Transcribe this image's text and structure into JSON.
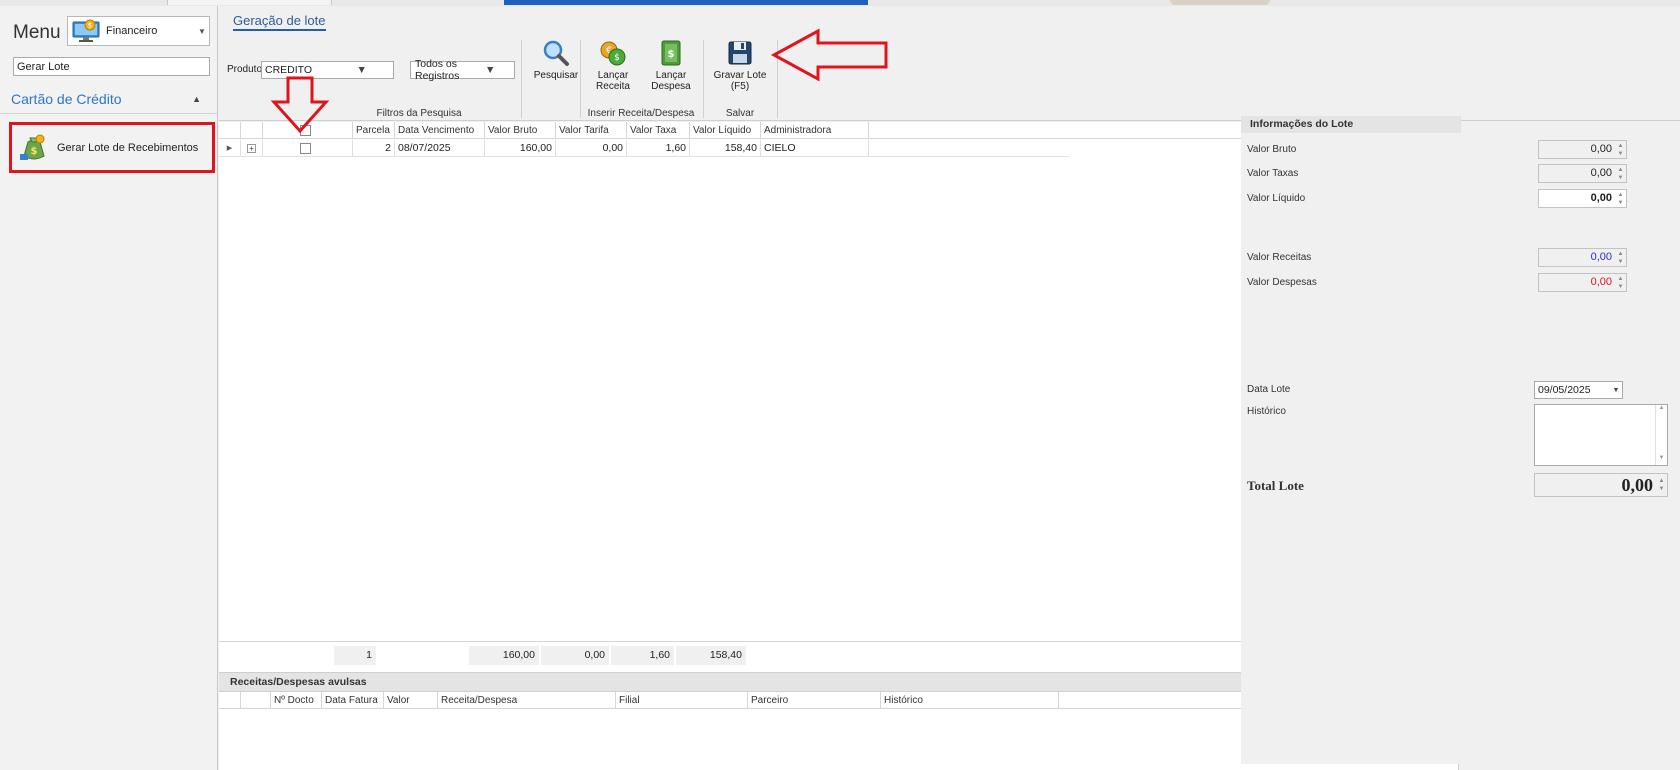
{
  "menu": {
    "title": "Menu",
    "module": "Financeiro",
    "search_value": "Gerar Lote",
    "group": "Cartão de Crédito",
    "item": "Gerar Lote de Recebimentos"
  },
  "doc_tab": "Geração de lote",
  "ribbon": {
    "produto_label": "Produto",
    "produto_value": "CREDITO",
    "registros_value": "Todos os Registros",
    "filters_caption": "Filtros da Pesquisa",
    "pesquisar": "Pesquisar",
    "lancar_receita": [
      "Lançar",
      "Receita"
    ],
    "lancar_despesa": [
      "Lançar",
      "Despesa"
    ],
    "inserir_caption": "Inserir Receita/Despesa",
    "gravar_lote": [
      "Gravar Lote",
      "(F5)"
    ],
    "salvar_caption": "Salvar"
  },
  "grid": {
    "columns": [
      "Parcela",
      "Data Vencimento",
      "Valor Bruto",
      "Valor Tarifa",
      "Valor Taxa",
      "Valor Líquido",
      "Administradora"
    ],
    "rows": [
      {
        "parcela": "2",
        "vencimento": "08/07/2025",
        "bruto": "160,00",
        "tarifa": "0,00",
        "taxa": "1,60",
        "liquido": "158,40",
        "administradora": "CIELO"
      }
    ],
    "footer": {
      "count": "1",
      "bruto": "160,00",
      "tarifa": "0,00",
      "taxa": "1,60",
      "liquido": "158,40"
    }
  },
  "avulsas": {
    "title": "Receitas/Despesas avulsas",
    "columns": [
      "Nº Docto",
      "Data Fatura",
      "Valor",
      "Receita/Despesa",
      "Filial",
      "Parceiro",
      "Histórico"
    ]
  },
  "info": {
    "title": "Informações do Lote",
    "valor_bruto_label": "Valor Bruto",
    "valor_bruto": "0,00",
    "valor_taxas_label": "Valor Taxas",
    "valor_taxas": "0,00",
    "valor_liquido_label": "Valor Líquido",
    "valor_liquido": "0,00",
    "valor_receitas_label": "Valor Receitas",
    "valor_receitas": "0,00",
    "valor_despesas_label": "Valor Despesas",
    "valor_despesas": "0,00",
    "data_lote_label": "Data Lote",
    "data_lote": "09/05/2025",
    "historico_label": "Histórico",
    "total_label": "Total Lote",
    "total": "0,00"
  },
  "colors": {
    "annotation": "#e0141c",
    "accent": "#2e75c7",
    "receitas": "#2b2bd6",
    "despesas": "#e0141c"
  }
}
